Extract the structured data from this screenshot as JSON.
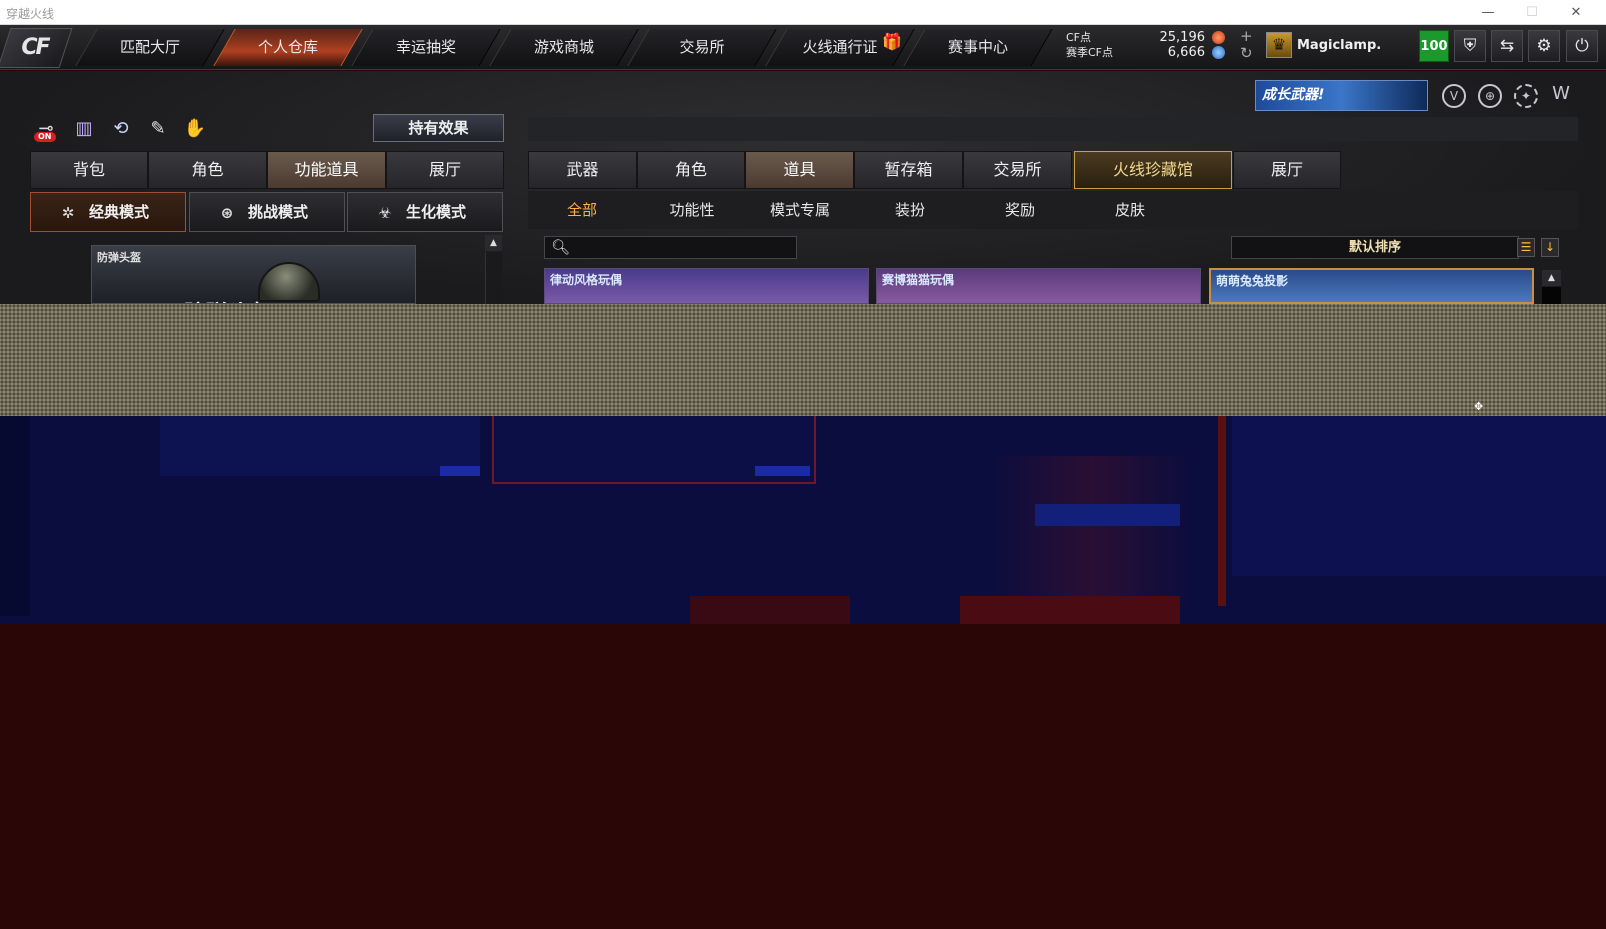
{
  "window": {
    "title": "穿越火线"
  },
  "nav": {
    "logo": "CF",
    "tabs": [
      "匹配大厅",
      "个人仓库",
      "幸运抽奖",
      "游戏商城",
      "交易所",
      "火线通行证",
      "赛事中心"
    ],
    "active_tab": "个人仓库"
  },
  "currency": {
    "cf_label": "CF点",
    "cf_value": "25,196",
    "season_label": "赛季CF点",
    "season_value": "6,666"
  },
  "user": {
    "name": "Magiclamp.",
    "level": "100"
  },
  "promo": {
    "banner_text": "成长武器!"
  },
  "left_panel": {
    "effect_button": "持有效果",
    "tabs": [
      "背包",
      "角色",
      "功能道具",
      "展厅"
    ],
    "active_tab": "功能道具",
    "modes": [
      "经典模式",
      "挑战模式",
      "生化模式"
    ],
    "active_mode": "经典模式",
    "item": {
      "label": "防弹头盔",
      "big_name": "防弹头盔"
    }
  },
  "right_panel": {
    "tabs": [
      "武器",
      "角色",
      "道具",
      "暂存箱",
      "交易所",
      "火线珍藏馆",
      "展厅"
    ],
    "active_tab": "道具",
    "highlight_tab": "火线珍藏馆",
    "subcategories": [
      "全部",
      "功能性",
      "模式专属",
      "装扮",
      "奖励",
      "皮肤"
    ],
    "active_subcategory": "全部",
    "search": {
      "value": "",
      "placeholder": ""
    },
    "sort": {
      "selected": "默认排序"
    },
    "items": [
      "律动风格玩偶",
      "赛博猫猫玩偶",
      "萌萌兔兔投影"
    ]
  },
  "colors": {
    "accent_orange": "#ffb040",
    "active_nav": "#b04020",
    "level_green": "#1a9a2a",
    "glitch_blue": "#0a0d3e",
    "glitch_red": "#2a0606"
  }
}
